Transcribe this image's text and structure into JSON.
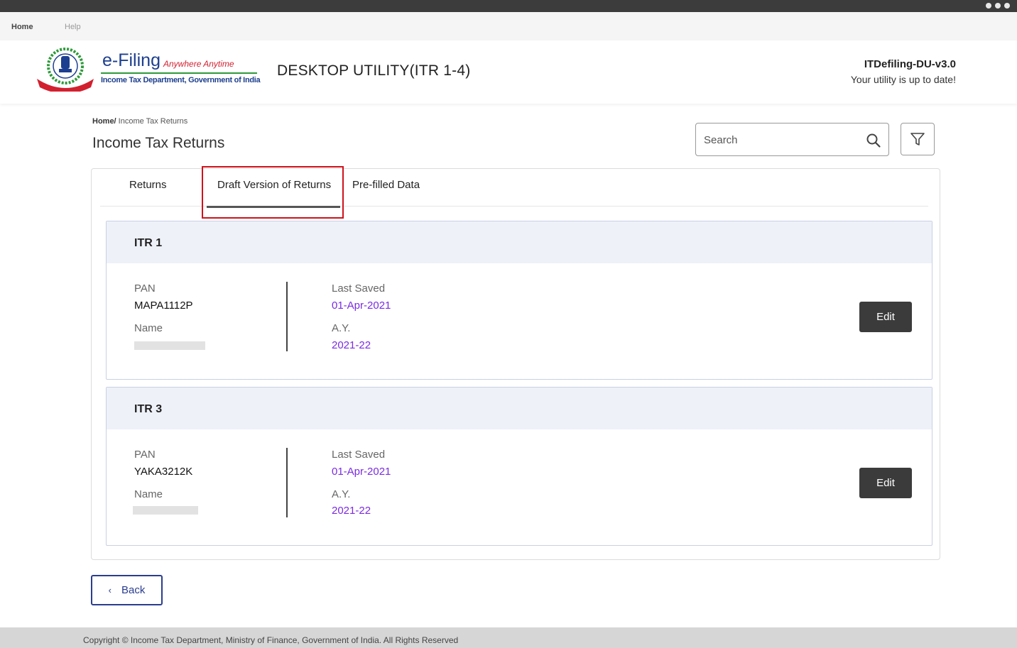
{
  "menu": {
    "home": "Home",
    "help": "Help"
  },
  "header": {
    "brand_main": "e-Filing",
    "brand_tagline": "Anywhere Anytime",
    "brand_sub": "Income Tax Department, Government of India",
    "app_title": "DESKTOP UTILITY(ITR 1-4)",
    "version": "ITDefiling-DU-v3.0",
    "version_status": "Your utility is up to date!"
  },
  "breadcrumb": {
    "home": "Home/",
    "current": " Income Tax Returns"
  },
  "page_title": "Income Tax Returns",
  "search": {
    "placeholder": "Search",
    "value": ""
  },
  "tabs": [
    {
      "label": "Returns",
      "active": false
    },
    {
      "label": "Draft Version of Returns",
      "active": true
    },
    {
      "label": "Pre-filled Data",
      "active": false
    }
  ],
  "returns": [
    {
      "form": "ITR 1",
      "pan_label": "PAN",
      "pan": "MAPA1112P",
      "name_label": "Name",
      "name": "",
      "last_saved_label": "Last Saved",
      "last_saved": "01-Apr-2021",
      "ay_label": "A.Y.",
      "ay": "2021-22",
      "edit_label": "Edit"
    },
    {
      "form": "ITR 3",
      "pan_label": "PAN",
      "pan": "YAKA3212K",
      "name_label": "Name",
      "name": "",
      "last_saved_label": "Last Saved",
      "last_saved": "01-Apr-2021",
      "ay_label": "A.Y.",
      "ay": "2021-22",
      "edit_label": "Edit"
    }
  ],
  "back_label": "Back",
  "footer": "Copyright © Income Tax Department, Ministry of Finance, Government of India. All Rights Reserved",
  "colors": {
    "accent": "#7a2be2",
    "highlight": "#d0121b",
    "primary": "#2a3d8f",
    "button_dark": "#3b3b3b"
  }
}
